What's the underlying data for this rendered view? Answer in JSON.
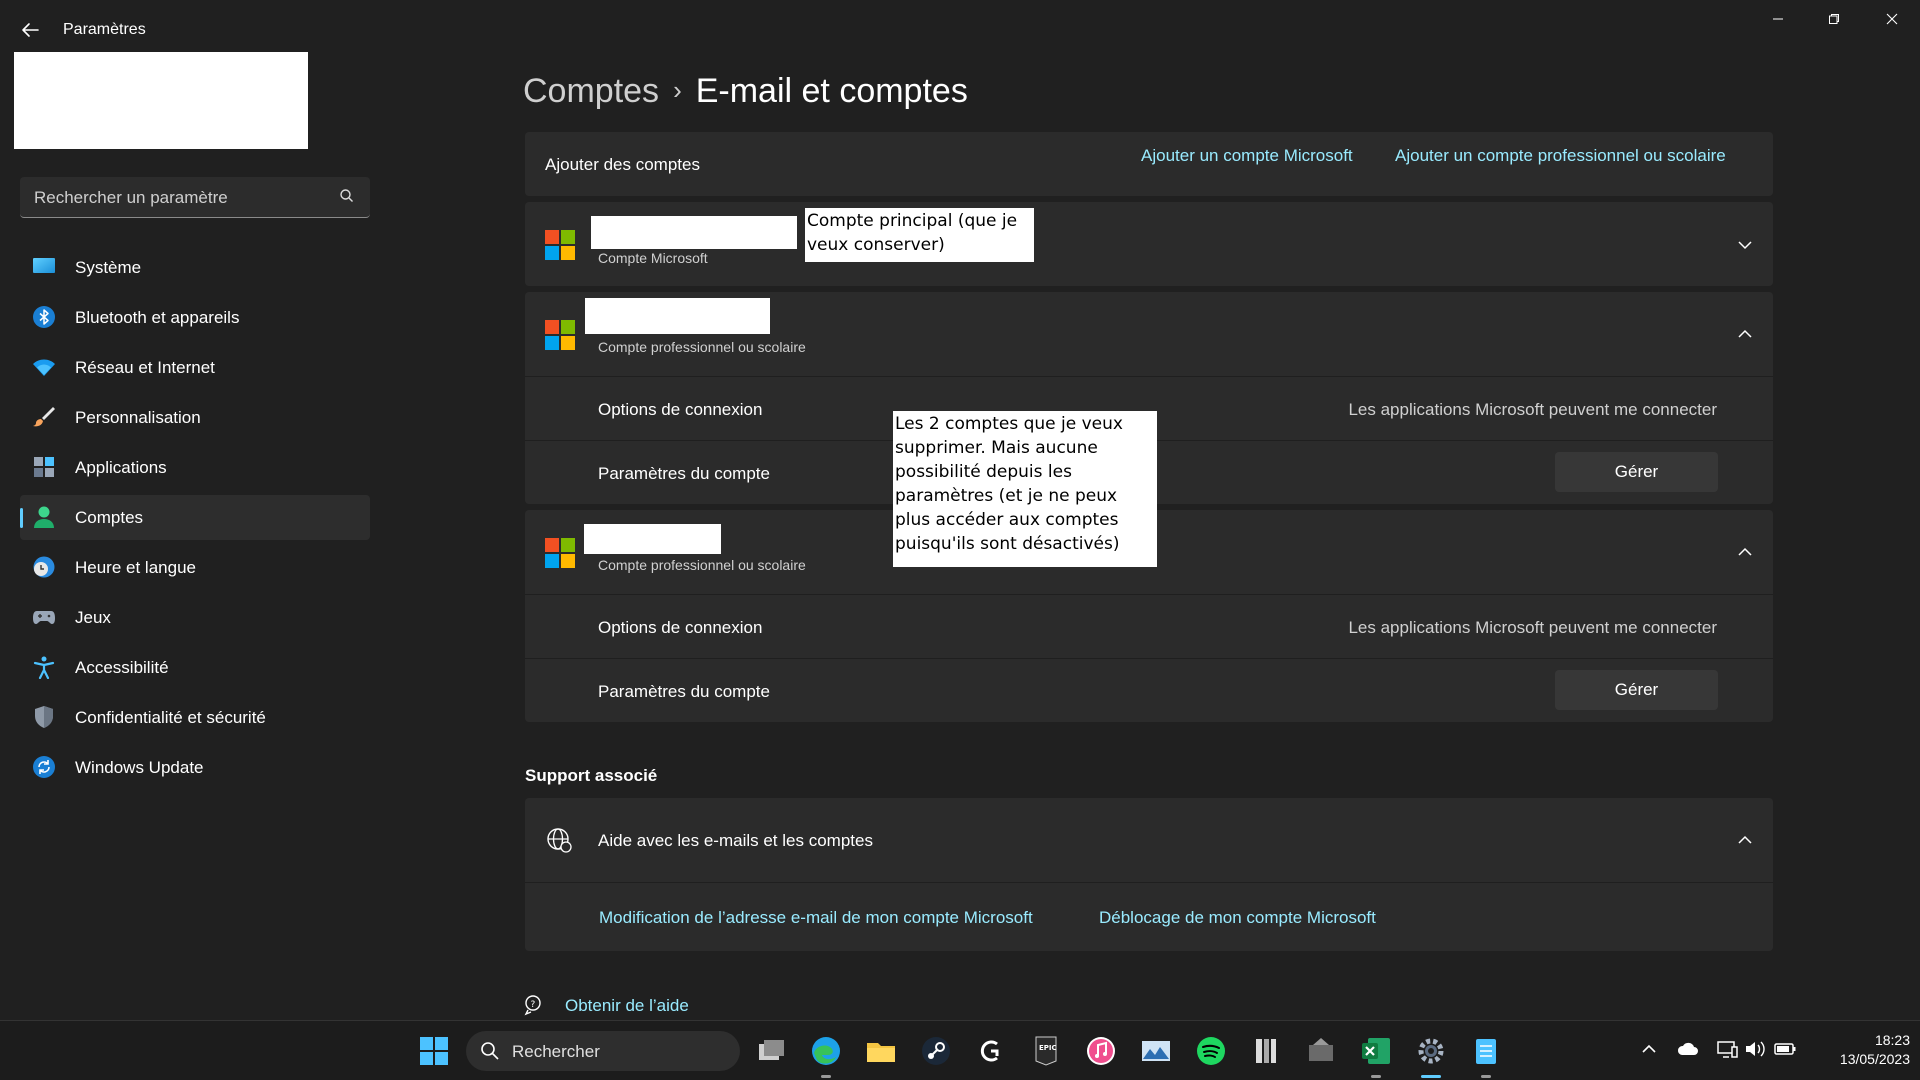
{
  "window": {
    "title": "Paramètres",
    "back_icon": "arrow-left-icon",
    "controls": [
      "minimize-icon",
      "maximize-icon",
      "close-icon"
    ]
  },
  "sidebar": {
    "search_placeholder": "Rechercher un paramètre",
    "items": [
      {
        "label": "Système",
        "icon": "monitor-icon"
      },
      {
        "label": "Bluetooth et appareils",
        "icon": "bluetooth-icon"
      },
      {
        "label": "Réseau et Internet",
        "icon": "wifi-icon"
      },
      {
        "label": "Personnalisation",
        "icon": "brush-icon"
      },
      {
        "label": "Applications",
        "icon": "apps-icon"
      },
      {
        "label": "Comptes",
        "icon": "user-icon",
        "active": true
      },
      {
        "label": "Heure et langue",
        "icon": "clock-globe-icon"
      },
      {
        "label": "Jeux",
        "icon": "gamepad-icon"
      },
      {
        "label": "Accessibilité",
        "icon": "accessibility-icon"
      },
      {
        "label": "Confidentialité et sécurité",
        "icon": "shield-icon"
      },
      {
        "label": "Windows Update",
        "icon": "update-icon"
      }
    ]
  },
  "breadcrumb": {
    "parent": "Comptes",
    "separator": "›",
    "current": "E-mail et comptes"
  },
  "add_accounts": {
    "label": "Ajouter des comptes",
    "add_microsoft": "Ajouter un compte Microsoft",
    "add_work": "Ajouter un compte professionnel ou scolaire"
  },
  "accounts": [
    {
      "type": "Compte Microsoft",
      "expanded": false
    },
    {
      "type": "Compte professionnel ou scolaire",
      "expanded": true,
      "options_label": "Options de connexion",
      "options_value": "Les applications Microsoft peuvent me connecter",
      "settings_label": "Paramètres du compte",
      "manage_label": "Gérer"
    },
    {
      "type": "Compte professionnel ou scolaire",
      "expanded": true,
      "options_label": "Options de connexion",
      "options_value": "Les applications Microsoft peuvent me connecter",
      "settings_label": "Paramètres du compte",
      "manage_label": "Gérer"
    }
  ],
  "annotations": {
    "main_account": "Compte principal (que je veux conserver)",
    "remove_accounts": "Les 2 comptes que je veux supprimer. Mais aucune possibilité depuis les paramètres (et je ne peux plus accéder aux comptes puisqu'ils sont désactivés)"
  },
  "support": {
    "section_title": "Support associé",
    "help_label": "Aide avec les e-mails et les comptes",
    "link_change_email": "Modification de l’adresse e-mail de mon compte Microsoft",
    "link_unlock": "Déblocage de mon compte Microsoft",
    "get_help": "Obtenir de l’aide"
  },
  "taskbar": {
    "search_label": "Rechercher",
    "apps": [
      "windows-start-icon",
      "task-view-icon",
      "edge-icon",
      "file-explorer-icon",
      "steam-icon",
      "logitech-icon",
      "epic-games-icon",
      "itunes-icon",
      "photo-app-icon",
      "spotify-icon",
      "app-icon",
      "app-icon-2",
      "excel-icon",
      "settings-icon",
      "notepad-icon"
    ],
    "time": "18:23",
    "date": "13/05/2023"
  },
  "colors": {
    "background": "#202020",
    "card": "#2b2b2b",
    "accent": "#60cdff",
    "link": "#99ebff"
  }
}
